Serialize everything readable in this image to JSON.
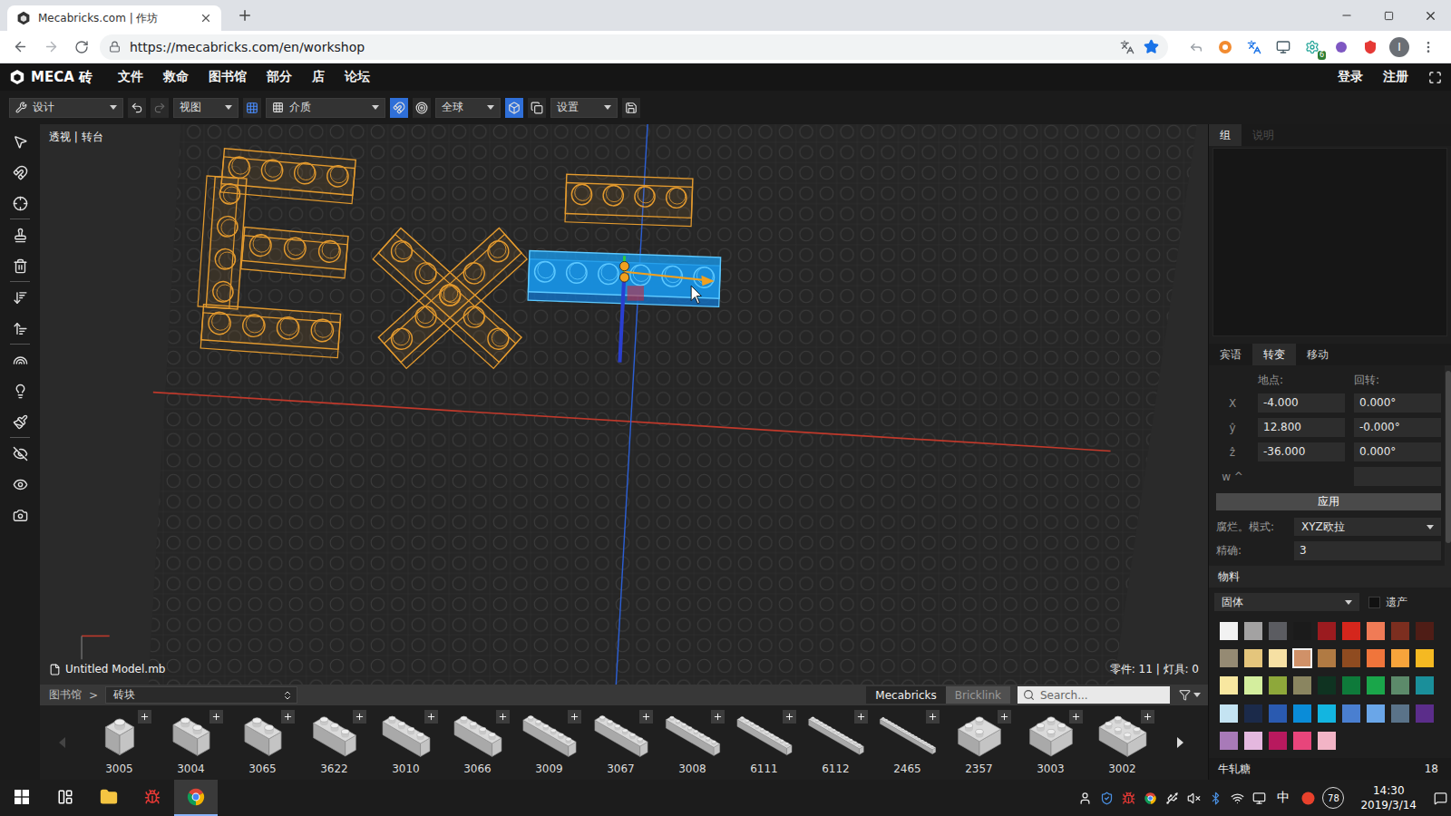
{
  "browser": {
    "tab": {
      "title": "Mecabricks.com | 作坊",
      "selected": true
    },
    "url": "https://mecabricks.com/en/workshop",
    "extension_badge": "6",
    "profile_initial": "I"
  },
  "app": {
    "logo": "MECA 砖",
    "menu": [
      "文件",
      "救命",
      "图书馆",
      "部分",
      "店",
      "论坛"
    ],
    "account": [
      "登录",
      "注册"
    ]
  },
  "toolbar": {
    "mode": "设计",
    "view": "视图",
    "grid": "介质",
    "space": "全球",
    "settings": "设置",
    "toggles": [
      {
        "on": true
      },
      {
        "on": true
      },
      {
        "on": false
      },
      {
        "on": true
      },
      {
        "on": false
      }
    ]
  },
  "viewport": {
    "camera": "透视 | 转台",
    "file": "Untitled Model.mb",
    "stats": "零件: 11 | 灯具: 0",
    "bricks": [
      {
        "selected": false
      },
      {
        "selected": false
      },
      {
        "selected": false
      },
      {
        "selected": false
      },
      {
        "selected": false
      },
      {
        "selected": false
      },
      {
        "selected": false
      },
      {
        "selected": true
      }
    ]
  },
  "properties": {
    "top_tabs": [
      {
        "label": "组",
        "selected": true,
        "disabled": false
      },
      {
        "label": "说明",
        "selected": false,
        "disabled": true
      }
    ],
    "transform_tabs": [
      {
        "label": "宾语",
        "selected": false
      },
      {
        "label": "转变",
        "selected": true
      },
      {
        "label": "移动",
        "selected": false
      }
    ],
    "location_label": "地点:",
    "rotation_label": "回转:",
    "rows": [
      {
        "axis": "X",
        "location": "-4.000",
        "rotation": "0.000°"
      },
      {
        "axis": "ŷ",
        "location": "12.800",
        "rotation": "-0.000°"
      },
      {
        "axis": "ẑ",
        "location": "-36.000",
        "rotation": "0.000°"
      }
    ],
    "w_label": "w ^",
    "apply": "应用",
    "mode_label": "腐烂。模式:",
    "mode_value": "XYZ欧拉",
    "precision_label": "精确:",
    "precision": "3"
  },
  "materials": {
    "title": "物料",
    "type": "固体",
    "legacy": {
      "label": "遗产",
      "checked": false
    },
    "swatches": [
      {
        "color": "#f2f2f2",
        "selected": false
      },
      {
        "color": "#a3a2a2",
        "selected": false
      },
      {
        "color": "#5b5c61",
        "selected": false
      },
      {
        "color": "#1b1b1b",
        "selected": false
      },
      {
        "color": "#9b1b1f",
        "selected": false
      },
      {
        "color": "#d5261c",
        "selected": false
      },
      {
        "color": "#f07b56",
        "selected": false
      },
      {
        "color": "#7c2e1f",
        "selected": false
      },
      {
        "color": "#4f1d16",
        "selected": false
      },
      {
        "color": "#958a73",
        "selected": false
      },
      {
        "color": "#e4c57c",
        "selected": false
      },
      {
        "color": "#f6e0a3",
        "selected": false
      },
      {
        "color": "#d09168",
        "selected": true
      },
      {
        "color": "#b07a43",
        "selected": false
      },
      {
        "color": "#8f4b20",
        "selected": false
      },
      {
        "color": "#f0753b",
        "selected": false
      },
      {
        "color": "#f7a43b",
        "selected": false
      },
      {
        "color": "#f5b922",
        "selected": false
      },
      {
        "color": "#f8e7a0",
        "selected": false
      },
      {
        "color": "#d4ee9e",
        "selected": false
      },
      {
        "color": "#8ea83a",
        "selected": false
      },
      {
        "color": "#8a8560",
        "selected": false
      },
      {
        "color": "#0f3321",
        "selected": false
      },
      {
        "color": "#0e7a3a",
        "selected": false
      },
      {
        "color": "#1aa64a",
        "selected": false
      },
      {
        "color": "#5c8a6a",
        "selected": false
      },
      {
        "color": "#1a8f9a",
        "selected": false
      },
      {
        "color": "#c4e3f2",
        "selected": false
      },
      {
        "color": "#1b2a4a",
        "selected": false
      },
      {
        "color": "#2a5ab0",
        "selected": false
      },
      {
        "color": "#0a8cd8",
        "selected": false
      },
      {
        "color": "#13b5e0",
        "selected": false
      },
      {
        "color": "#4a7fd0",
        "selected": false
      },
      {
        "color": "#6aa6e8",
        "selected": false
      },
      {
        "color": "#5a7389",
        "selected": false
      },
      {
        "color": "#5b2d8a",
        "selected": false
      },
      {
        "color": "#a87ab8",
        "selected": false
      },
      {
        "color": "#e4b8df",
        "selected": false
      },
      {
        "color": "#b8195e",
        "selected": false
      },
      {
        "color": "#e8457b",
        "selected": false
      },
      {
        "color": "#f2b4c6",
        "selected": false
      }
    ],
    "selected_name": "牛轧糖",
    "selected_id": "18"
  },
  "library": {
    "label": "图书馆",
    "separator": ">",
    "category": "砖块",
    "sources": [
      {
        "label": "Mecabricks",
        "selected": true
      },
      {
        "label": "Bricklink",
        "selected": false
      }
    ],
    "search_placeholder": "Search...",
    "prev_disabled": true,
    "parts": [
      {
        "id": "3005",
        "kind": "1x1"
      },
      {
        "id": "3004",
        "kind": "1x2"
      },
      {
        "id": "3065",
        "kind": "1x2"
      },
      {
        "id": "3622",
        "kind": "1x3"
      },
      {
        "id": "3010",
        "kind": "1x4"
      },
      {
        "id": "3066",
        "kind": "1x4"
      },
      {
        "id": "3009",
        "kind": "1x6"
      },
      {
        "id": "3067",
        "kind": "1x6"
      },
      {
        "id": "3008",
        "kind": "1x8"
      },
      {
        "id": "6111",
        "kind": "1x10"
      },
      {
        "id": "6112",
        "kind": "1x12"
      },
      {
        "id": "2465",
        "kind": "1x16"
      },
      {
        "id": "2357",
        "kind": "corner"
      },
      {
        "id": "3003",
        "kind": "2x2"
      },
      {
        "id": "3002",
        "kind": "2x3"
      }
    ]
  },
  "taskbar": {
    "ime": "中",
    "badge": "78",
    "time": "14:30",
    "date": "2019/3/14"
  }
}
